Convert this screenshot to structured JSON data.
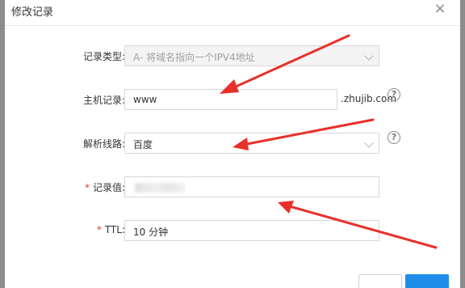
{
  "dialog": {
    "title": "修改记录",
    "close_icon": "close-icon"
  },
  "form": {
    "record_type": {
      "label": "记录类型:",
      "value": "A- 将域名指向一个IPV4地址"
    },
    "host": {
      "label": "主机记录:",
      "value": "www",
      "suffix": ".zhujib.com",
      "help": "?"
    },
    "line": {
      "label": "解析线路:",
      "value": "百度",
      "help": "?"
    },
    "record_value": {
      "required": "*",
      "label": "记录值:",
      "value": ""
    },
    "ttl": {
      "required": "*",
      "label": "TTL:",
      "value": "10 分钟"
    }
  },
  "colors": {
    "annotation_arrow": "#e8302a",
    "primary_button": "#1f8ee8",
    "required_star": "#e03c3c"
  }
}
